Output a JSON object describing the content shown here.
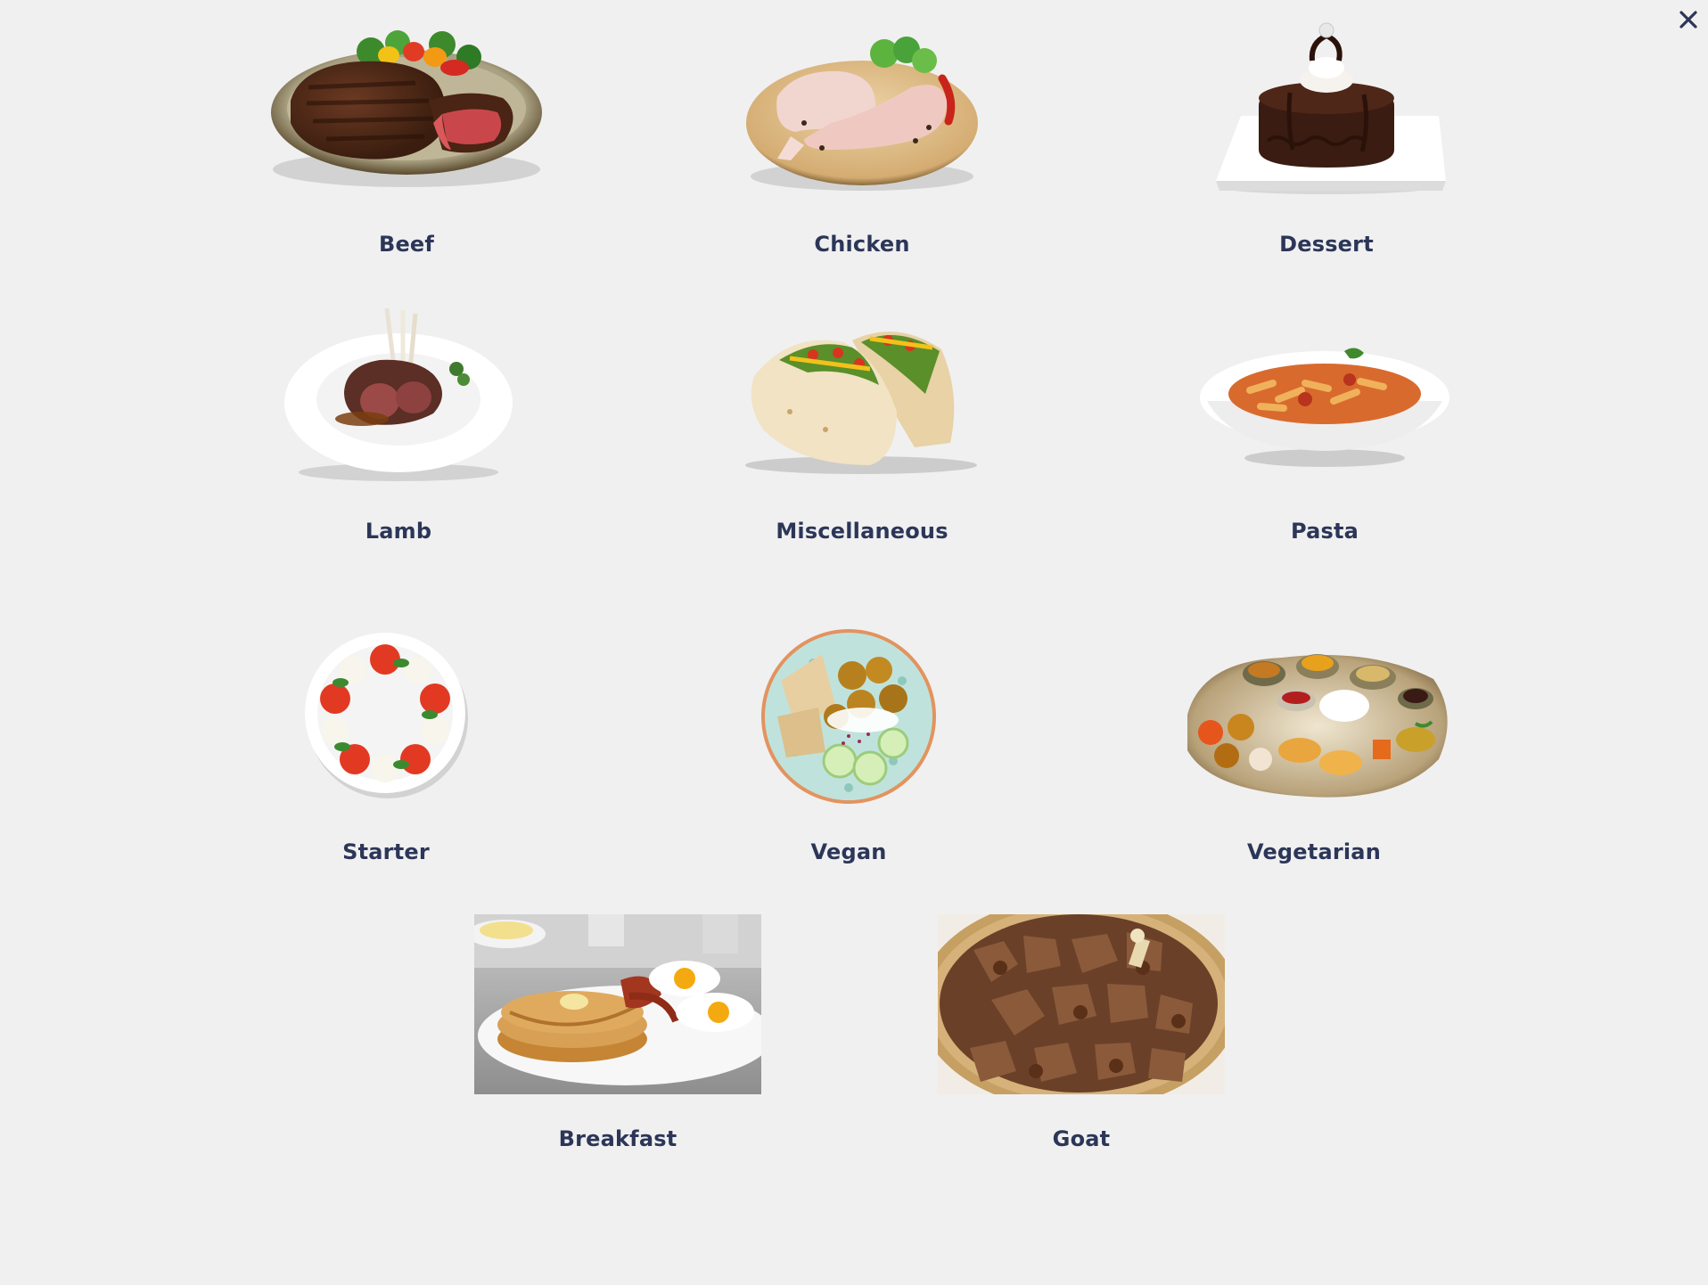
{
  "close": {
    "icon": "close-icon"
  },
  "categories": [
    {
      "id": "beef",
      "label": "Beef",
      "icon": "steak-plate"
    },
    {
      "id": "chicken",
      "label": "Chicken",
      "icon": "raw-chicken-board"
    },
    {
      "id": "dessert",
      "label": "Dessert",
      "icon": "chocolate-cake-plate"
    },
    {
      "id": "lamb",
      "label": "Lamb",
      "icon": "lamb-chops-plate"
    },
    {
      "id": "miscellaneous",
      "label": "Miscellaneous",
      "icon": "tacos"
    },
    {
      "id": "pasta",
      "label": "Pasta",
      "icon": "penne-bowl"
    },
    {
      "id": "starter",
      "label": "Starter",
      "icon": "caprese-plate"
    },
    {
      "id": "vegan",
      "label": "Vegan",
      "icon": "falafel-bowl"
    },
    {
      "id": "vegetarian",
      "label": "Vegetarian",
      "icon": "thali-platter"
    },
    {
      "id": "breakfast",
      "label": "Breakfast",
      "icon": "pancakes-eggs-photo"
    },
    {
      "id": "goat",
      "label": "Goat",
      "icon": "goat-curry-photo"
    }
  ],
  "colors": {
    "background": "#f0f0f0",
    "label": "#2c3658",
    "close": "#2c3658"
  }
}
